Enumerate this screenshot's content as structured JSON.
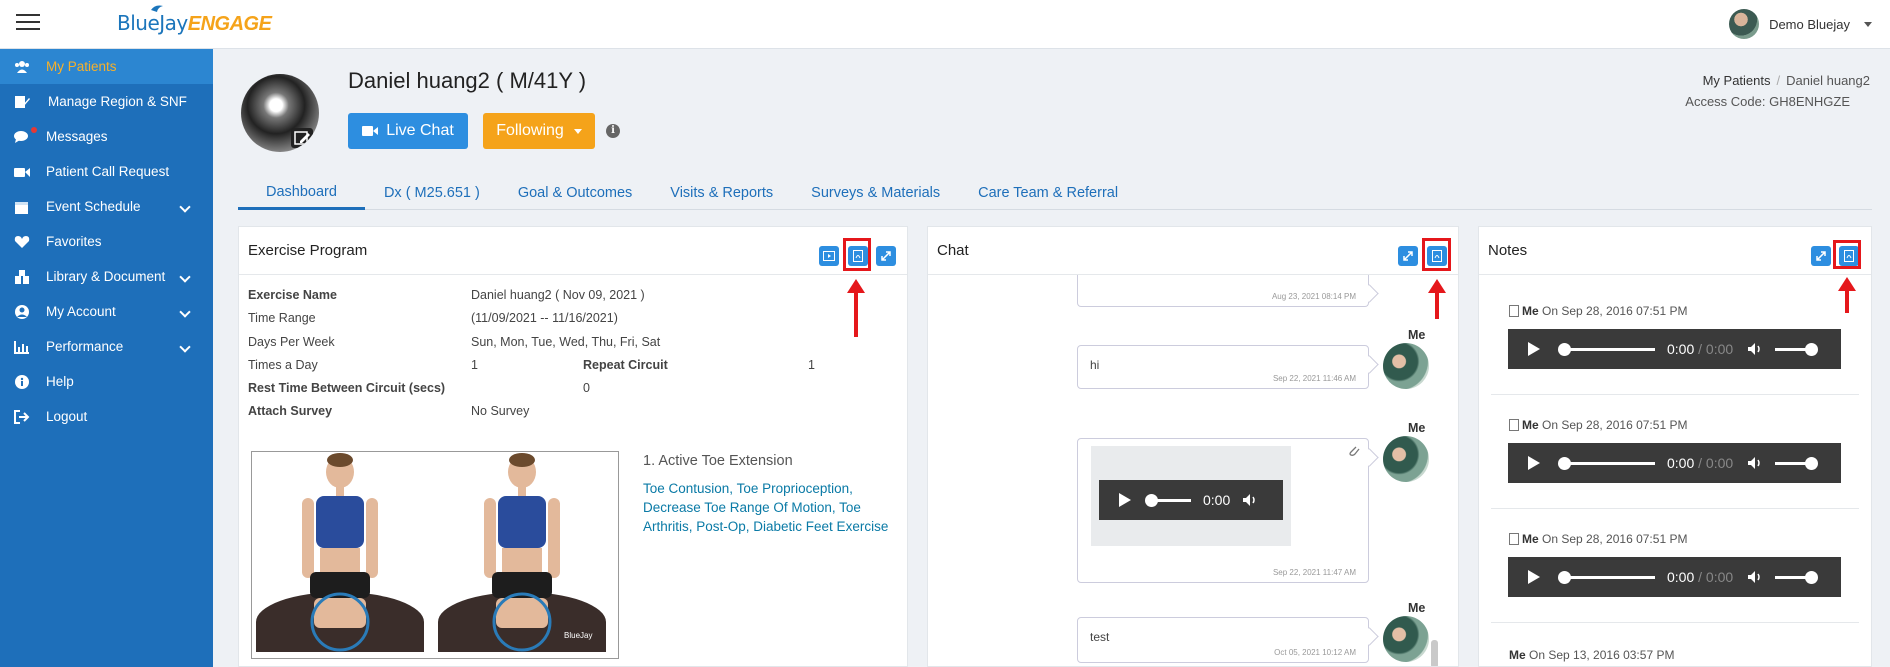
{
  "app": {
    "logo_part1": "BlueJay",
    "logo_part2": "ENGAGE"
  },
  "user": {
    "name": "Demo Bluejay"
  },
  "sidebar": {
    "items": [
      {
        "label": "My Patients",
        "icon": "users-icon"
      },
      {
        "label": "Manage Region & SNF",
        "icon": "edit-doc-icon"
      },
      {
        "label": "Messages",
        "icon": "chat-icon"
      },
      {
        "label": "Patient Call Request",
        "icon": "video-icon"
      },
      {
        "label": "Event Schedule",
        "icon": "calendar-icon"
      },
      {
        "label": "Favorites",
        "icon": "heart-icon"
      },
      {
        "label": "Library & Document",
        "icon": "library-icon"
      },
      {
        "label": "My Account",
        "icon": "account-icon"
      },
      {
        "label": "Performance",
        "icon": "chart-icon"
      },
      {
        "label": "Help",
        "icon": "info-icon"
      },
      {
        "label": "Logout",
        "icon": "logout-icon"
      }
    ]
  },
  "patient": {
    "title": "Daniel huang2 ( M/41Y )",
    "live_chat": "Live Chat",
    "following": "Following"
  },
  "breadcrumb": {
    "root": "My Patients",
    "current": "Daniel huang2"
  },
  "access_code": "Access Code: GH8ENHGZE",
  "tabs": [
    "Dashboard",
    "Dx ( M25.651 )",
    "Goal & Outcomes",
    "Visits & Reports",
    "Surveys & Materials",
    "Care Team & Referral"
  ],
  "exercise": {
    "title": "Exercise Program",
    "rows": {
      "name_label": "Exercise Name",
      "name_value": "Daniel huang2 ( Nov 09, 2021 )",
      "range_label": "Time Range",
      "range_value": "(11/09/2021 -- 11/16/2021)",
      "days_label": "Days Per Week",
      "days_value": "Sun, Mon, Tue, Wed, Thu, Fri, Sat",
      "times_label": "Times a Day",
      "times_value": "1",
      "repeat_label": "Repeat Circuit",
      "repeat_value": "1",
      "rest_label": "Rest Time Between Circuit (secs)",
      "rest_value": "0",
      "survey_label": "Attach Survey",
      "survey_value": "No Survey"
    },
    "item_name": "1. Active Toe Extension",
    "item_tags": "Toe Contusion, Toe Proprioception, Decrease Toe Range Of Motion, Toe Arthritis, Post-Op, Diabetic Feet Exercise",
    "watermark": "BlueJay"
  },
  "chat": {
    "title": "Chat",
    "me_label": "Me",
    "messages": [
      {
        "text": "",
        "time": "Aug 23, 2021 08:14 PM"
      },
      {
        "text": "hi",
        "time": "Sep 22, 2021 11:46 AM"
      },
      {
        "text": "",
        "time": "Sep 22, 2021 11:47 AM"
      },
      {
        "text": "test",
        "time": "Oct 05, 2021 10:12 AM"
      }
    ],
    "audio_time": "0:00"
  },
  "notes": {
    "title": "Notes",
    "author": "Me",
    "entries": [
      {
        "date": "On Sep 28, 2016 07:51 PM"
      },
      {
        "date": "On Sep 28, 2016 07:51 PM"
      },
      {
        "date": "On Sep 28, 2016 07:51 PM"
      },
      {
        "date": "On Sep 13, 2016 03:57 PM"
      }
    ],
    "player_current": "0:00",
    "player_sep": " / ",
    "player_total": "0:00"
  },
  "colors": {
    "sidebar": "#1e6fba",
    "accent": "#2d8ee0",
    "active_nav_text": "#f7b02a",
    "follow_button": "#f5a31a",
    "highlight": "#e5171b"
  }
}
